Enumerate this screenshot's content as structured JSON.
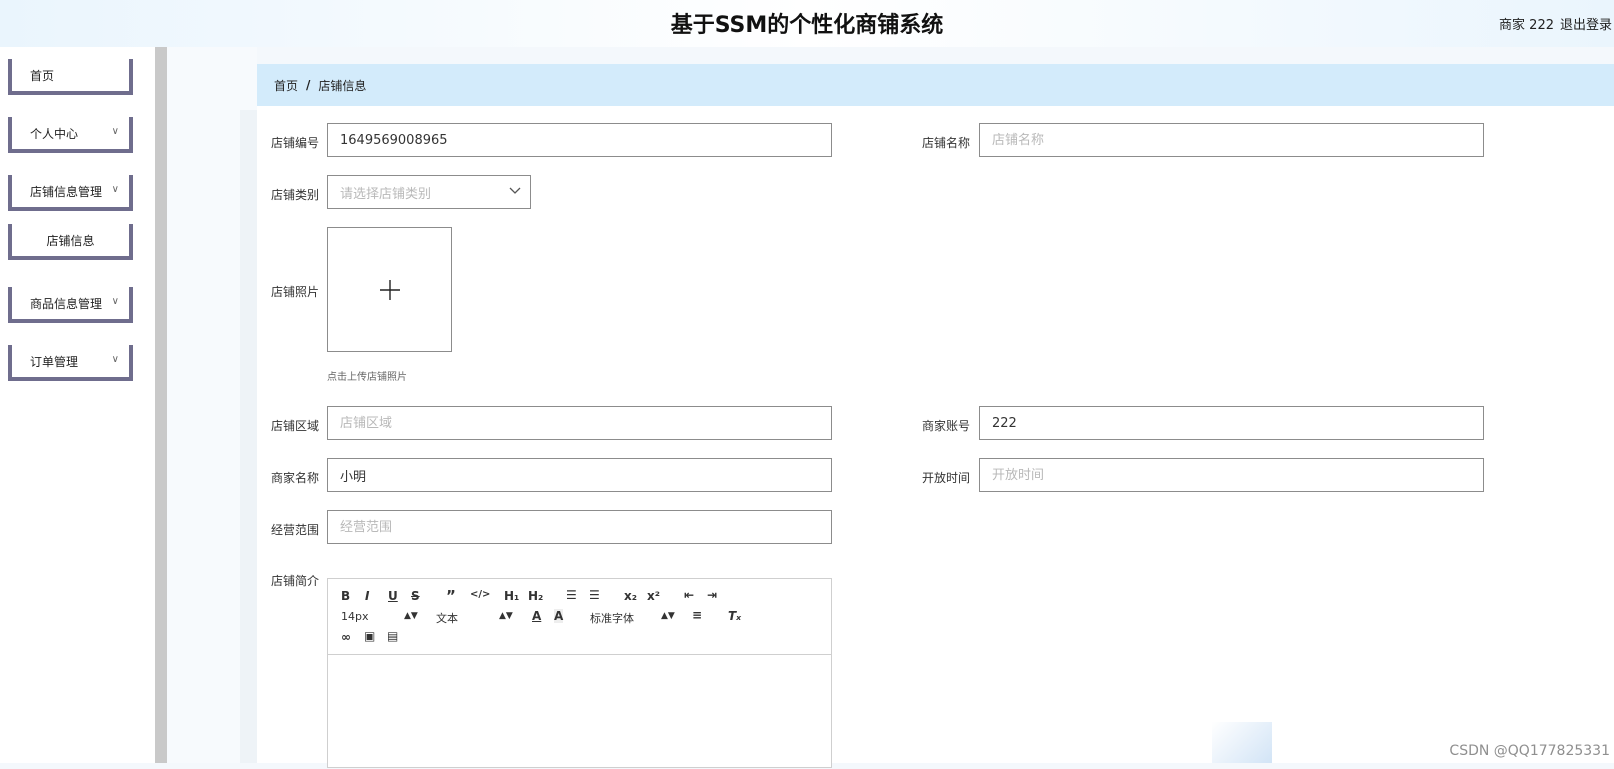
{
  "header": {
    "title": "基于SSM的个性化商铺系统",
    "user": "商家 222",
    "logout": "退出登录"
  },
  "sidebar": {
    "items": [
      {
        "label": "首页"
      },
      {
        "label": "个人中心"
      },
      {
        "label": "店铺信息管理"
      },
      {
        "label": "店铺信息"
      },
      {
        "label": "商品信息管理"
      },
      {
        "label": "订单管理"
      }
    ]
  },
  "breadcrumb": {
    "home": "首页",
    "separator": "/",
    "current": "店铺信息"
  },
  "form": {
    "shop_no": {
      "label": "店铺编号",
      "value": "1649569008965"
    },
    "shop_name": {
      "label": "店铺名称",
      "placeholder": "店铺名称"
    },
    "shop_type": {
      "label": "店铺类别",
      "placeholder": "请选择店铺类别"
    },
    "shop_photo": {
      "label": "店铺照片",
      "hint": "点击上传店铺照片"
    },
    "shop_area": {
      "label": "店铺区域",
      "placeholder": "店铺区域"
    },
    "merchant_account": {
      "label": "商家账号",
      "value": "222"
    },
    "merchant_name": {
      "label": "商家名称",
      "value": "小明"
    },
    "open_time": {
      "label": "开放时间",
      "placeholder": "开放时间"
    },
    "business_scope": {
      "label": "经营范围",
      "placeholder": "经营范围"
    },
    "shop_intro": {
      "label": "店铺简介"
    }
  },
  "editor": {
    "font_size": "14px",
    "header_select": "文本",
    "font_family": "标准字体"
  },
  "watermark": "CSDN @QQ177825331"
}
